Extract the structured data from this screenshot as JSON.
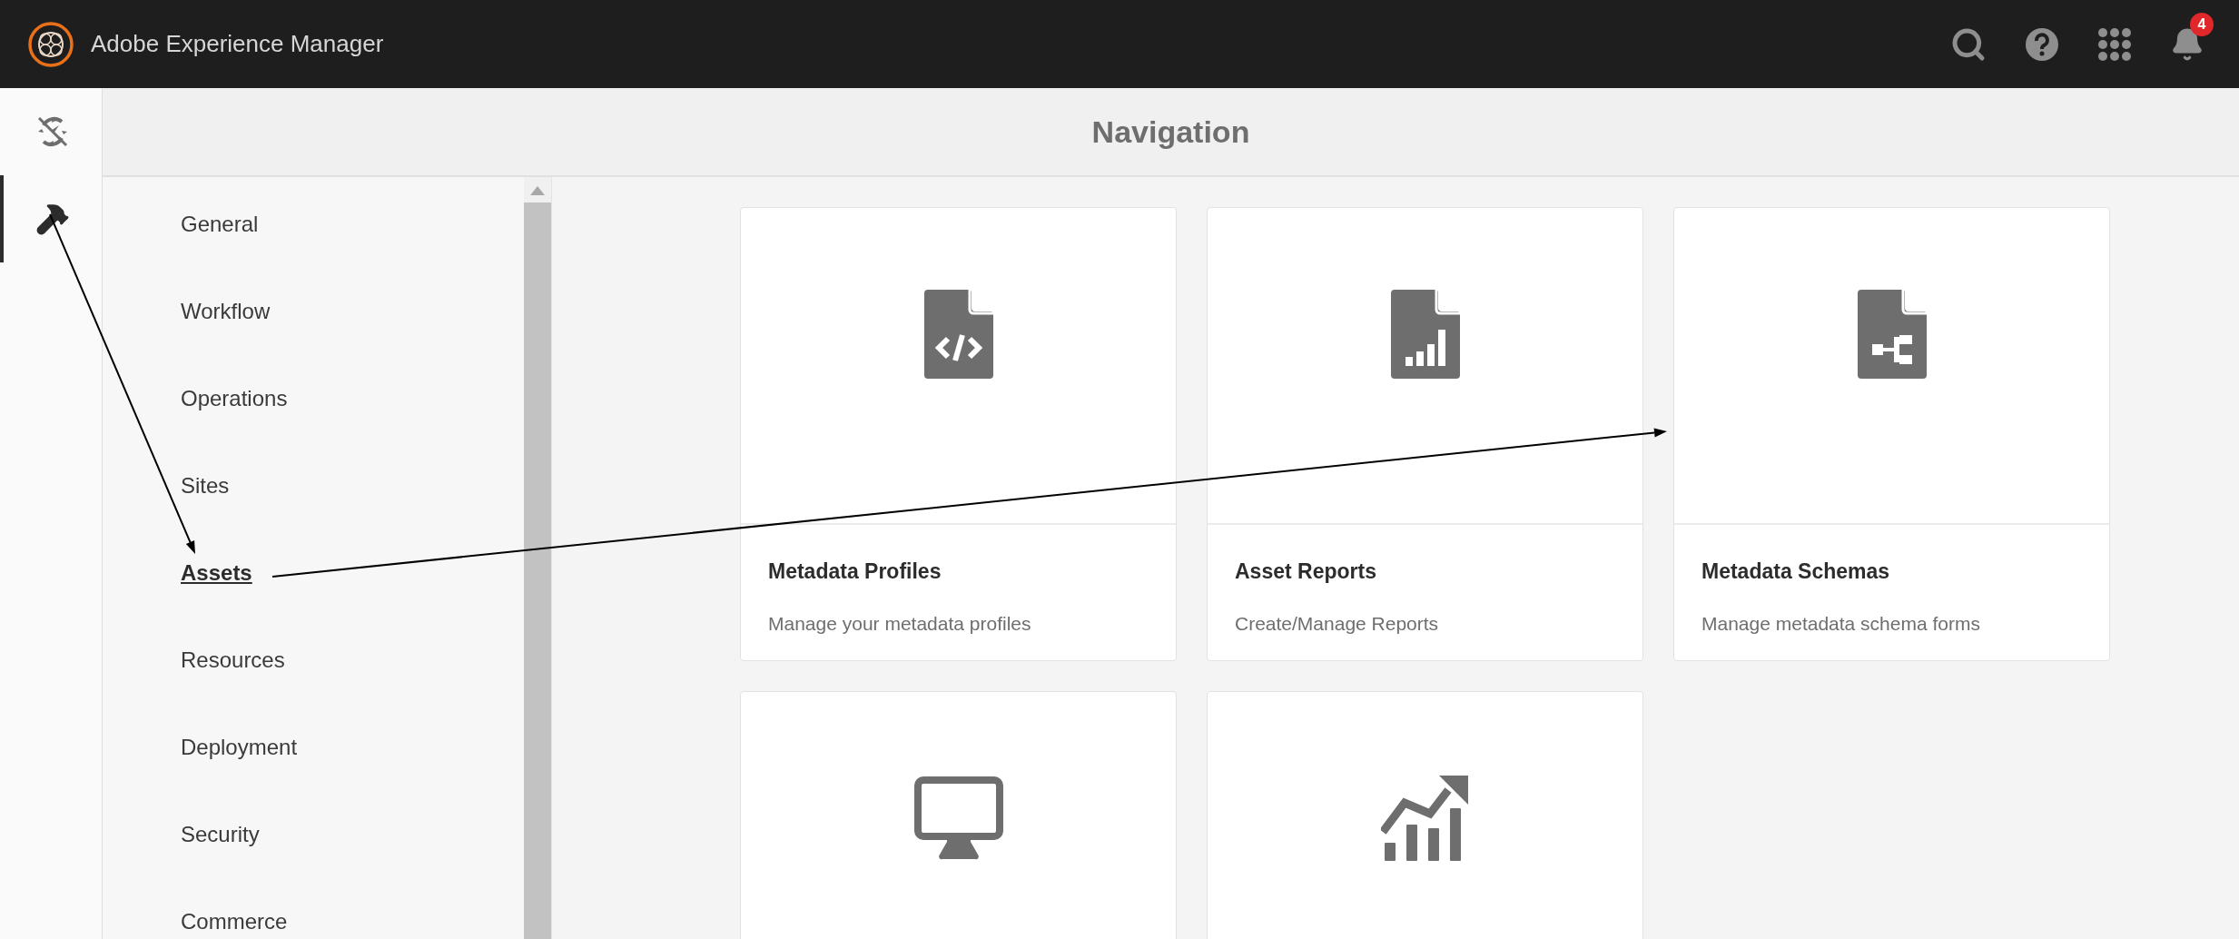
{
  "header": {
    "title": "Adobe Experience Manager",
    "notifications": "4"
  },
  "rail": [
    {
      "kind": "navigation",
      "selected": false
    },
    {
      "kind": "tools",
      "selected": true
    }
  ],
  "page_title": "Navigation",
  "menu": [
    {
      "label": "General",
      "selected": false
    },
    {
      "label": "Workflow",
      "selected": false
    },
    {
      "label": "Operations",
      "selected": false
    },
    {
      "label": "Sites",
      "selected": false
    },
    {
      "label": "Assets",
      "selected": true
    },
    {
      "label": "Resources",
      "selected": false
    },
    {
      "label": "Deployment",
      "selected": false
    },
    {
      "label": "Security",
      "selected": false
    },
    {
      "label": "Commerce",
      "selected": false
    }
  ],
  "cards": [
    {
      "kind": "code-file",
      "title": "Metadata Profiles",
      "description": "Manage your metadata profiles"
    },
    {
      "kind": "chart-file",
      "title": "Asset Reports",
      "description": "Create/Manage Reports"
    },
    {
      "kind": "schema-file",
      "title": "Metadata Schemas",
      "description": "Manage metadata schema forms"
    },
    {
      "kind": "monitor"
    },
    {
      "kind": "growth-chart"
    }
  ]
}
